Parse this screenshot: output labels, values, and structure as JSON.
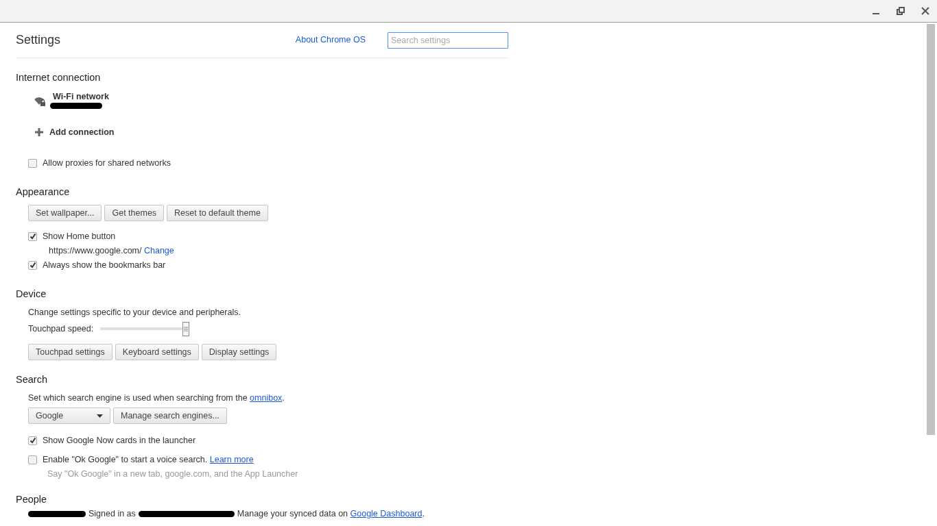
{
  "header": {
    "title": "Settings",
    "about_link": "About Chrome OS",
    "search": {
      "placeholder": "Search settings"
    }
  },
  "sections": [
    {
      "heading": "Internet connection",
      "items": [
        {
          "kind": "network",
          "label": "Wi-Fi network"
        },
        {
          "kind": "add",
          "label": "Add connection"
        },
        {
          "kind": "checkbox",
          "label": "Allow proxies for shared networks",
          "checked": false
        }
      ]
    },
    {
      "heading": "Appearance",
      "items": [
        {
          "kind": "buttons",
          "buttons": [
            "Set wallpaper...",
            "Get themes",
            "Reset to default theme"
          ]
        },
        {
          "kind": "checkbox",
          "label": "Show Home button",
          "checked": true
        },
        {
          "kind": "url",
          "text": "https://www.google.com/",
          "link": "Change"
        },
        {
          "kind": "checkbox",
          "label": "Always show the bookmarks bar",
          "checked": true
        }
      ]
    },
    {
      "heading": "Device",
      "items": [
        {
          "kind": "text",
          "text": "Change settings specific to your device and peripherals."
        },
        {
          "kind": "slider",
          "label": "Touchpad speed:",
          "level": 1
        },
        {
          "kind": "buttons",
          "buttons": [
            "Touchpad settings",
            "Keyboard settings",
            "Display settings"
          ]
        }
      ]
    },
    {
      "heading": "Search",
      "items": [
        {
          "kind": "text",
          "text": "Set which search engine is used when searching from the ",
          "link": "omnibox",
          "after": "."
        },
        {
          "kind": "select",
          "value": "Google",
          "button": "Manage search engines..."
        },
        {
          "kind": "checkbox",
          "label": "Show Google Now cards in the launcher",
          "checked": true
        },
        {
          "kind": "checkbox",
          "label": "Enable \"Ok Google\" to start a voice search.",
          "link": "Learn more",
          "checked": false
        },
        {
          "kind": "hint",
          "text": "Say \"Ok Google\" in a new tab, google.com, and the App Launcher"
        }
      ]
    },
    {
      "heading": "People",
      "items": [
        {
          "kind": "signin",
          "text": "Signed in as",
          "text2": "Manage your synced data on ",
          "link": "Google Dashboard",
          "after": "."
        }
      ]
    }
  ]
}
